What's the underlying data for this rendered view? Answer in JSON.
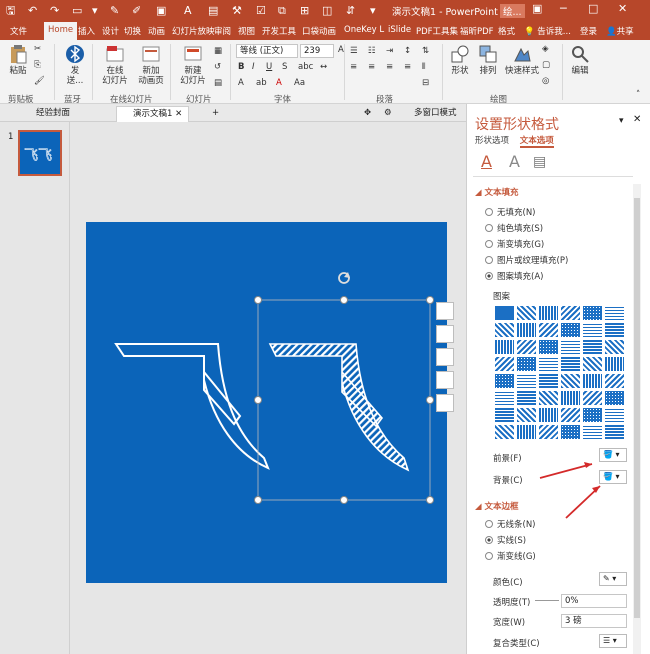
{
  "title_bar": {
    "title": "演示文稿1 - PowerPoint",
    "user_short": "绘...",
    "signin": "登录",
    "share": "共享",
    "tell_me": "告诉我..."
  },
  "tabs": [
    "文件",
    "Home",
    "插入",
    "设计",
    "切换",
    "动画",
    "幻灯片放映",
    "审阅",
    "视图",
    "开发工具",
    "口袋动画",
    "OneKey L",
    "iSlide",
    "PDF工具集",
    "福昕PDF",
    "格式"
  ],
  "ribbon": {
    "paste": "粘贴",
    "send_line1": "发",
    "send_line2": "送...",
    "online_line1": "在线",
    "online_line2": "幻灯片",
    "new_anim_line1": "新加",
    "new_anim_line2": "动画页",
    "new_slide_line1": "新建",
    "new_slide_line2": "幻灯片",
    "shape": "形状",
    "arrange": "排列",
    "quick_style": "快速样式",
    "edit": "编辑",
    "font_name": "等线 (正文)",
    "font_size": "239",
    "groups": [
      "剪贴板",
      "蓝牙",
      "在线幻灯片",
      "幻灯片",
      "字体",
      "段落",
      "绘图"
    ]
  },
  "doc_tabs": {
    "tab1": "经验封面",
    "tab2": "演示文稿1",
    "tab3": "多窗口模式"
  },
  "slide": {
    "number": "1",
    "text": "飞飞"
  },
  "panel": {
    "title": "设置形状格式",
    "tab_shape": "形状选项",
    "tab_text": "文本选项",
    "fill_section": "文本填充",
    "fill_options": [
      "无填充(N)",
      "纯色填充(S)",
      "渐变填充(G)",
      "图片或纹理填充(P)",
      "图案填充(A)"
    ],
    "pattern_label": "图案",
    "foreground": "前景(F)",
    "background": "背景(C)",
    "border_section": "文本边框",
    "border_options": [
      "无线条(N)",
      "实线(S)",
      "渐变线(G)"
    ],
    "color": "颜色(C)",
    "transparency": "透明度(T)",
    "transparency_value": "0%",
    "width": "宽度(W)",
    "width_value": "3 磅",
    "compound": "复合类型(C)"
  },
  "colors": {
    "brand": "#b7472a",
    "slide_blue": "#0b64b9",
    "accent": "#c55a3d"
  }
}
